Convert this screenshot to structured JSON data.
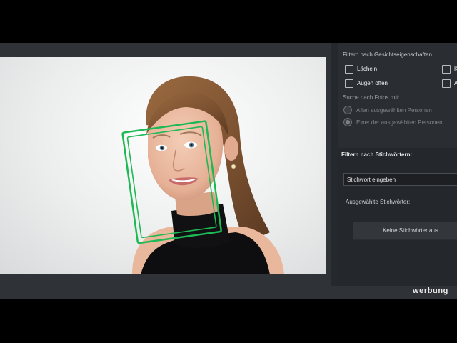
{
  "face_filter": {
    "heading": "Filtern nach Gesichtseigenschaften",
    "options": [
      {
        "label": "Lächeln",
        "checked": false
      },
      {
        "label": "Augen offen",
        "checked": false
      },
      {
        "label": "K",
        "checked": false
      },
      {
        "label": "A",
        "checked": false
      }
    ]
  },
  "search": {
    "heading": "Suche nach Fotos mit:",
    "options": [
      {
        "label": "Allen ausgewählten Personen",
        "selected": false
      },
      {
        "label": "Einer der ausgewählten Personen",
        "selected": true
      }
    ]
  },
  "keyword_filter": {
    "heading": "Filtern nach Stichwörtern:",
    "input_placeholder": "Stichwort eingeben",
    "selected_heading": "Ausgewählte Stichwörter:",
    "no_keywords_button": "Keine Stichwörter aus"
  },
  "photo": {
    "subject": "smiling-woman-portrait",
    "face_box_color": "#1db954"
  },
  "watermark": {
    "text": "werbung"
  }
}
